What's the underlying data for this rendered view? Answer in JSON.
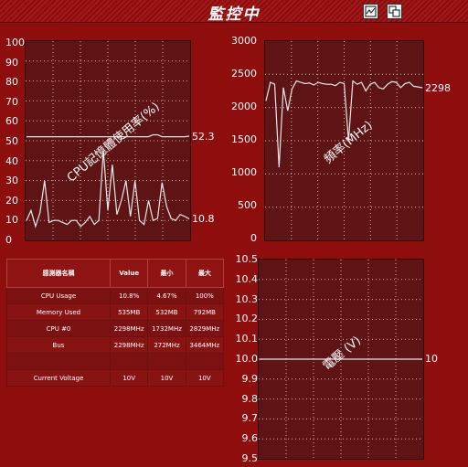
{
  "window": {
    "title": "監控中"
  },
  "toolbar": {
    "chart_icon": "chart-icon",
    "restore_icon": "restore-window-icon"
  },
  "colors": {
    "background": "#8e0d0d",
    "plot_bg": "#5e1414",
    "line": "#e8e8e8"
  },
  "cpu_panel": {
    "label": "CPU記憶體使用率(%)",
    "y_ticks": [
      "100",
      "90",
      "80",
      "70",
      "60",
      "50",
      "40",
      "30",
      "20",
      "10",
      "0"
    ],
    "memory_readout": "52.3",
    "cpu_readout": "10.8"
  },
  "freq_panel": {
    "label": "頻率(MHz)",
    "y_ticks": [
      "3000",
      "2500",
      "2000",
      "1500",
      "1000",
      "500",
      "0"
    ],
    "readout": "2298"
  },
  "voltage_panel": {
    "label": "電壓 (V)",
    "y_ticks": [
      "10.5",
      "10.4",
      "10.3",
      "10.2",
      "10.1",
      "10.0",
      "9.9",
      "9.8",
      "9.7",
      "9.6",
      "9.5"
    ],
    "readout": "10"
  },
  "sensor_table": {
    "headers": [
      "感測器名稱",
      "Value",
      "最小",
      "最大"
    ],
    "rows": [
      [
        "CPU Usage",
        "10.8%",
        "4.67%",
        "100%"
      ],
      [
        "Memory Used",
        "535MB",
        "532MB",
        "792MB"
      ],
      [
        "CPU #0",
        "2298MHz",
        "1732MHz",
        "2829MHz"
      ],
      [
        "Bus",
        "2298MHz",
        "272MHz",
        "3464MHz"
      ],
      [
        "",
        "",
        "",
        ""
      ],
      [
        "Current Voltage",
        "10V",
        "10V",
        "10V"
      ]
    ]
  },
  "chart_data": [
    {
      "type": "line",
      "title": "CPU記憶體使用率(%)",
      "ylim": [
        0,
        100
      ],
      "series": [
        {
          "values": [
            52,
            52,
            52,
            52,
            52,
            52,
            52,
            52,
            52,
            52,
            52,
            52,
            52,
            52,
            52,
            52,
            52,
            52,
            52,
            52,
            52,
            52,
            52,
            52,
            52,
            52,
            52,
            52,
            53,
            53,
            52,
            52,
            52,
            52,
            52,
            52,
            52.3
          ]
        },
        {
          "values": [
            10,
            15,
            7,
            14,
            30,
            9,
            10,
            10,
            9,
            8,
            10,
            10,
            7,
            9,
            12,
            8,
            10,
            45,
            15,
            38,
            13,
            20,
            30,
            12,
            30,
            10,
            8,
            20,
            10,
            11,
            29,
            17,
            11,
            10,
            13,
            12,
            10.8
          ]
        }
      ]
    },
    {
      "type": "line",
      "title": "頻率(MHz)",
      "ylim": [
        0,
        3000
      ],
      "series": [
        {
          "values": [
            2100,
            2380,
            2350,
            1100,
            2300,
            1950,
            2280,
            2400,
            2380,
            2360,
            2370,
            2340,
            2380,
            2360,
            2350,
            2350,
            2330,
            2380,
            2360,
            1500,
            2400,
            2350,
            2380,
            2250,
            2350,
            2380,
            2300,
            2280,
            2350,
            2390,
            2380,
            2300,
            2360,
            2380,
            2320,
            2310,
            2298
          ]
        }
      ]
    },
    {
      "type": "line",
      "title": "電壓 (V)",
      "ylim": [
        9.5,
        10.5
      ],
      "series": [
        {
          "values": [
            10,
            10,
            10,
            10,
            10,
            10,
            10,
            10,
            10,
            10,
            10,
            10,
            10,
            10,
            10,
            10,
            10,
            10,
            10,
            10,
            10,
            10,
            10,
            10,
            10,
            10,
            10,
            10,
            10,
            10,
            10,
            10,
            10,
            10,
            10,
            10,
            10
          ]
        }
      ]
    }
  ]
}
